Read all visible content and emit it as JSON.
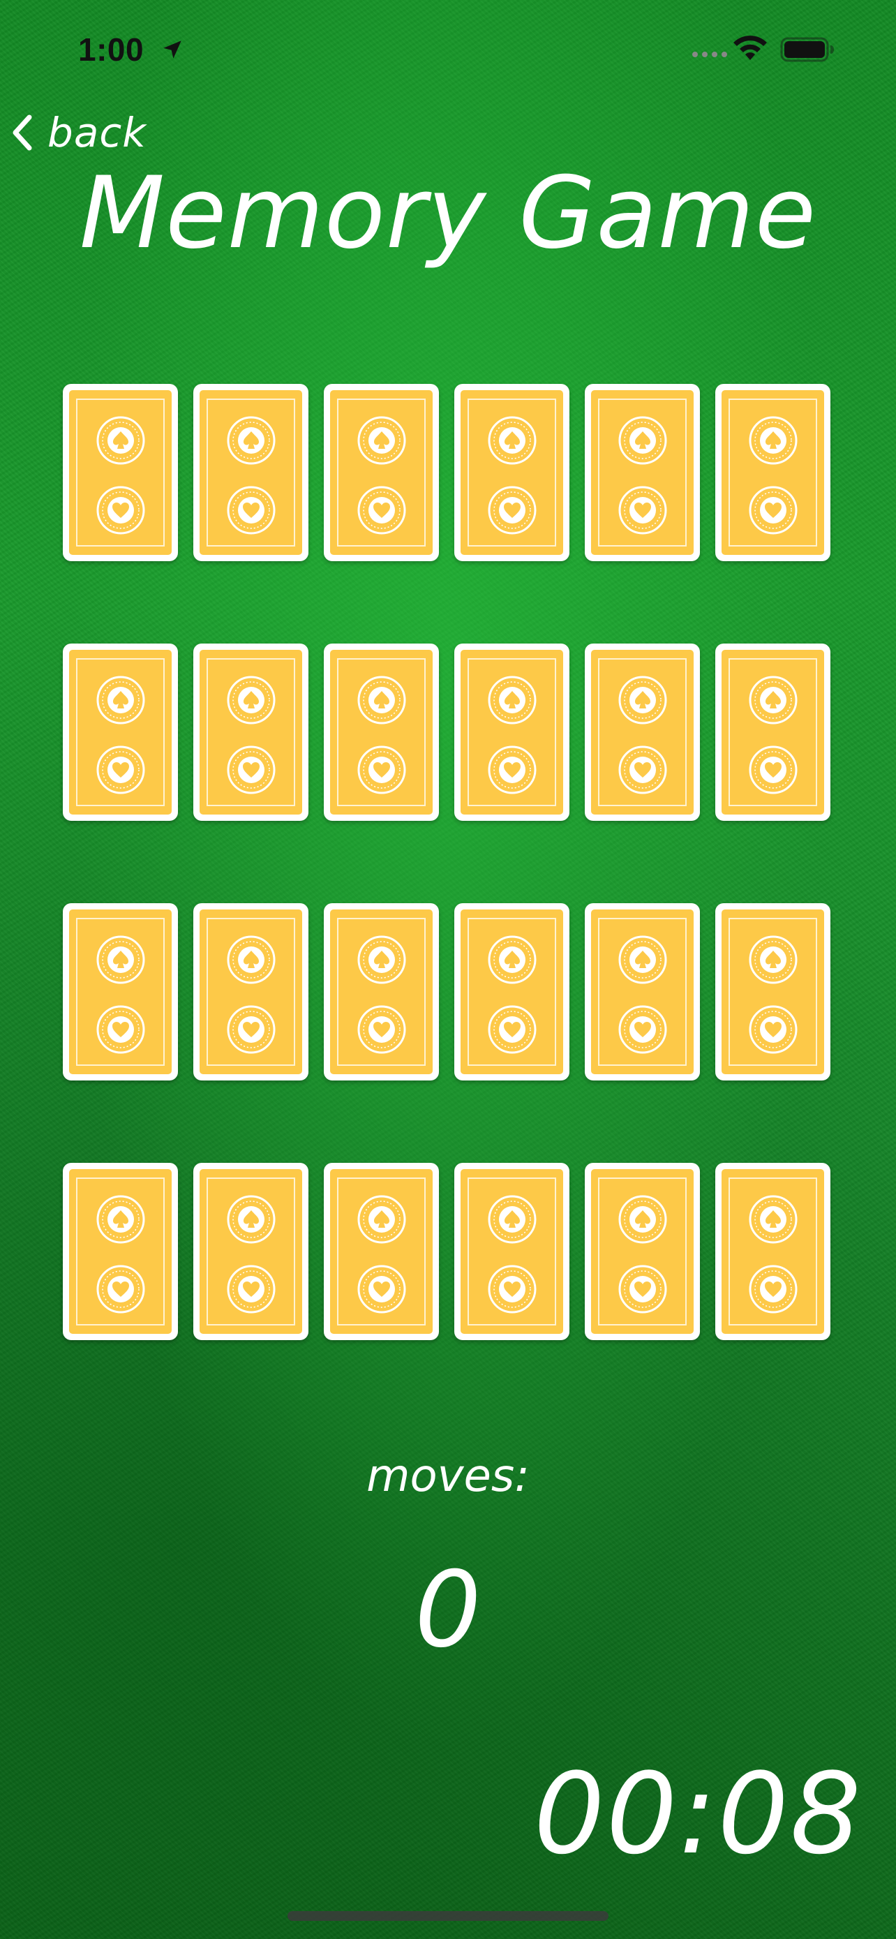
{
  "status_bar": {
    "time": "1:00",
    "icons": [
      "location-arrow-icon",
      "cellular-signal-icon",
      "wifi-icon",
      "battery-icon"
    ]
  },
  "navigation": {
    "back_label": "back",
    "back_icon": "chevron-left-icon"
  },
  "title": "Memory Game",
  "board": {
    "rows": 4,
    "columns": 6,
    "card_state": "face-down",
    "card_back_color": "#fdc948",
    "card_border_color": "#ffffff",
    "card_emblems": [
      "spade-emblem-icon",
      "heart-emblem-icon"
    ]
  },
  "moves": {
    "label": "moves:",
    "value": "0"
  },
  "timer": "00:08",
  "colors": {
    "table_felt": "#1a9a2c",
    "text": "#ffffff"
  }
}
